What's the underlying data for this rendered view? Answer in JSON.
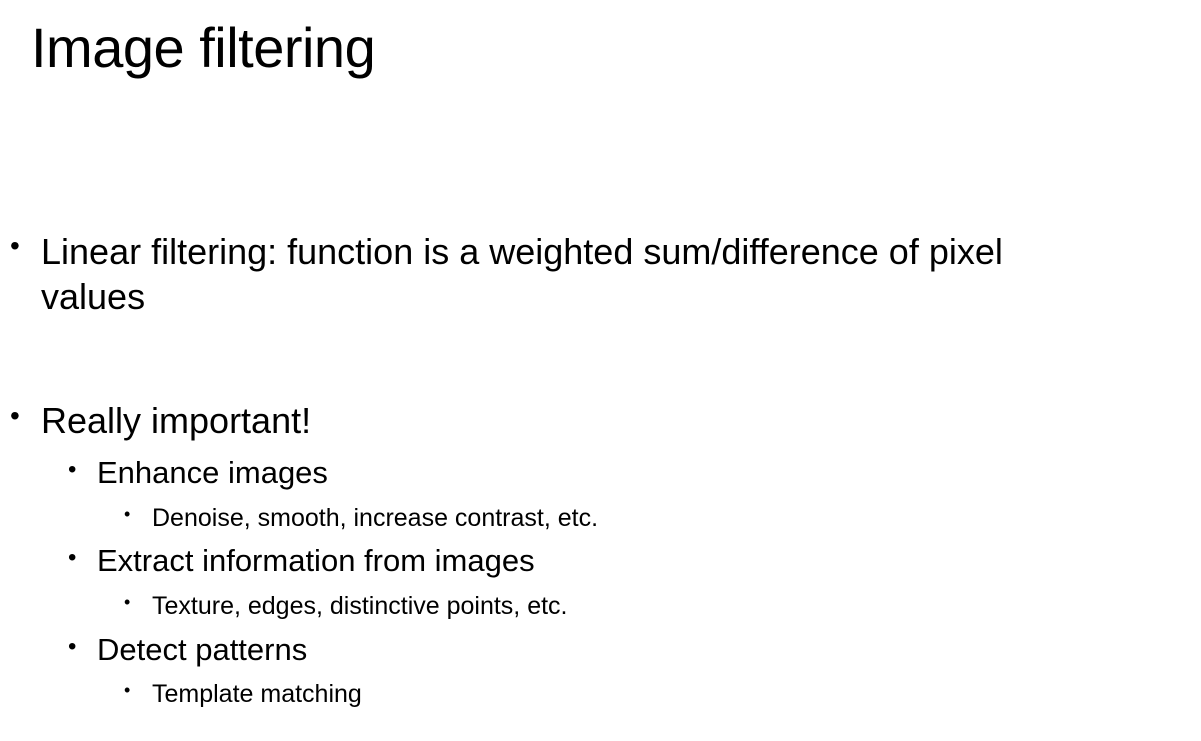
{
  "slide": {
    "title": "Image filtering",
    "bullet_symbol": "•",
    "items": [
      {
        "text_line1": "Linear filtering: function is a weighted sum/difference of pixel",
        "text_line2": "values"
      },
      {
        "text": "Really important!",
        "children": [
          {
            "text": "Enhance images",
            "children": [
              {
                "text": "Denoise, smooth, increase contrast, etc."
              }
            ]
          },
          {
            "text": "Extract information from images",
            "children": [
              {
                "text": "Texture, edges, distinctive points, etc."
              }
            ]
          },
          {
            "text": "Detect patterns",
            "children": [
              {
                "text": "Template matching"
              }
            ]
          }
        ]
      }
    ]
  }
}
